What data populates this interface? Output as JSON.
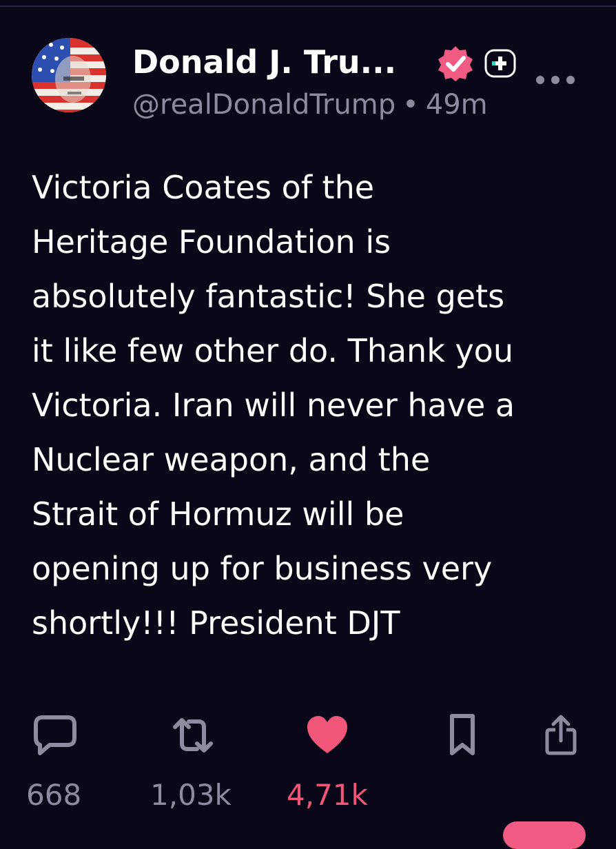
{
  "post": {
    "display_name": "Donald J. Tru...",
    "handle": "@realDonaldTrump",
    "separator": "•",
    "time": "49m",
    "text": "Victoria Coates of the\nHeritage Foundation is\nabsolutely fantastic! She gets\nit like few other do. Thank you\nVictoria. Iran will never have a\nNuclear weapon, and the\nStrait of Hormuz will be\nopening up for business very\nshortly!!! President DJT"
  },
  "actions": {
    "replies": {
      "icon": "comment-icon",
      "count": "668"
    },
    "reposts": {
      "icon": "repost-icon",
      "count": "1,03k"
    },
    "likes": {
      "icon": "heart-icon",
      "count": "4,71k",
      "liked": true
    },
    "bookmark": {
      "icon": "bookmark-icon"
    },
    "share": {
      "icon": "share-icon"
    }
  },
  "colors": {
    "background": "#0a0718",
    "text": "#ffffff",
    "muted": "#8e8ba1",
    "like": "#f0557a",
    "verified": "#f05b84"
  }
}
